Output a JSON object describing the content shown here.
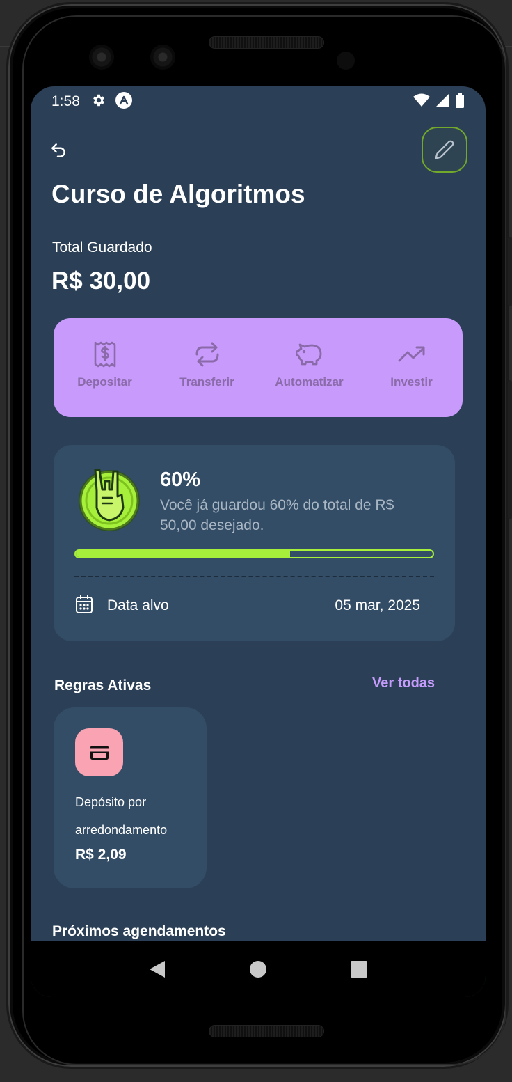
{
  "status_bar": {
    "time": "1:58",
    "left_icons": [
      "gear-icon",
      "notification-a-icon"
    ],
    "right_icons": [
      "wifi-icon",
      "signal-icon",
      "battery-icon"
    ]
  },
  "header": {
    "back_icon": "undo-arrow-icon",
    "edit_icon": "pencil-icon"
  },
  "goal": {
    "title": "Curso de Algoritmos",
    "total_label": "Total Guardado",
    "total_value": "R$ 30,00"
  },
  "actions": [
    {
      "label": "Depositar",
      "icon": "receipt-dollar-icon"
    },
    {
      "label": "Transferir",
      "icon": "transfer-arrows-icon"
    },
    {
      "label": "Automatizar",
      "icon": "piggy-bank-icon"
    },
    {
      "label": "Investir",
      "icon": "trending-up-icon"
    }
  ],
  "progress_card": {
    "percent_label": "60%",
    "progress": 0.6,
    "description": "Você já guardou 60% do total de R$ 50,00 desejado.",
    "target_date_label": "Data alvo",
    "target_date_value": "05 mar, 2025",
    "badge_icon": "rock-hand-badge-icon"
  },
  "rules": {
    "title": "Regras Ativas",
    "see_all": "Ver todas",
    "items": [
      {
        "name": "Depósito por arredondamento",
        "amount": "R$ 2,09",
        "icon": "credit-card-icon"
      }
    ]
  },
  "next_schedules_title": "Próximos agendamentos",
  "colors": {
    "screen_bg": "#2b3f56",
    "card_bg": "#334d66",
    "actions_bg": "#c79afc",
    "accent_green": "#a6ef3a",
    "accent_purple": "#c59cfb",
    "rule_icon_bg": "#f9a3b3"
  }
}
